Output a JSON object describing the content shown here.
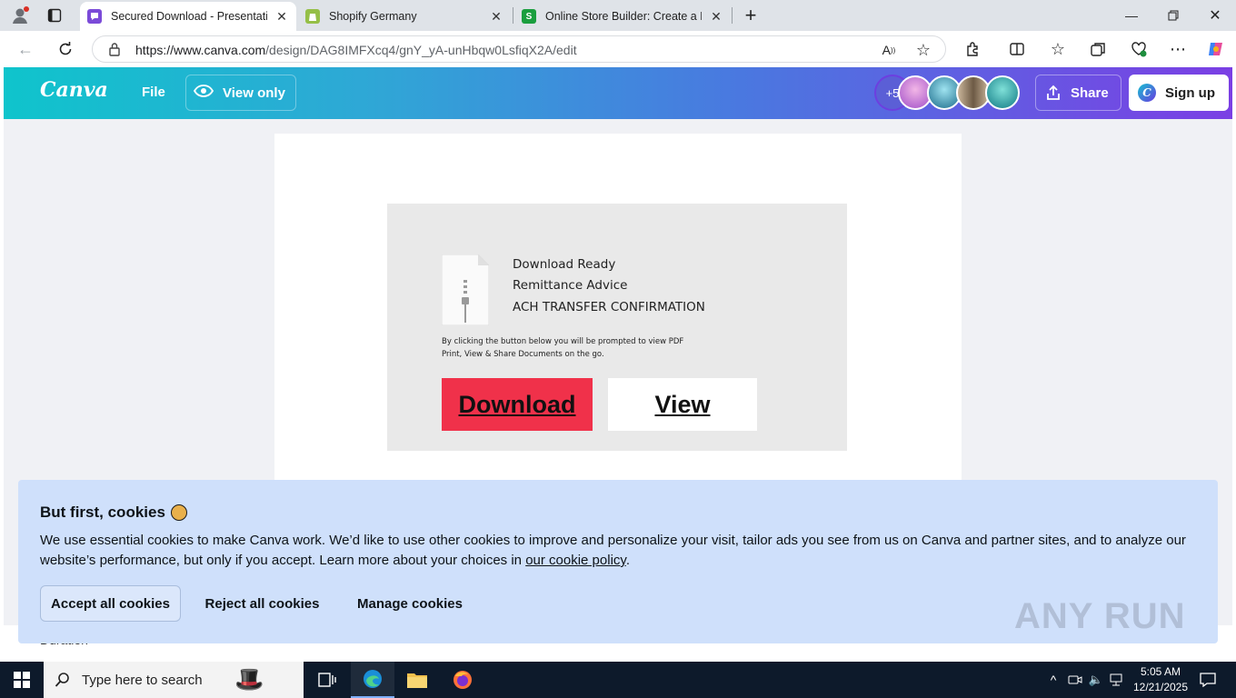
{
  "browser": {
    "tabs": [
      {
        "title": "Secured Download - Presentation",
        "active": true
      },
      {
        "title": "Shopify Germany",
        "active": false
      },
      {
        "title": "Online Store Builder: Create a Free",
        "active": false
      }
    ],
    "url_host": "https://www.canva.com",
    "url_path": "/design/DAG8IMFXcq4/gnY_yA-unHbqw0LsfiqX2A/edit"
  },
  "canva": {
    "logo": "Canva",
    "file_label": "File",
    "view_only_label": "View only",
    "collaborators_more": "+5",
    "share_label": "Share",
    "signup_label": "Sign up",
    "signup_badge": "C"
  },
  "design": {
    "line1": "Download Ready",
    "line2": "Remittance Advice",
    "line3": "ACH TRANSFER CONFIRMATION",
    "small1": "By clicking the button below you will be prompted to view PDF",
    "small2": "Print, View & Share Documents on the go.",
    "download_label": "Download",
    "view_label": "View",
    "colors": {
      "download_bg": "#f0314a",
      "card_bg": "#e9e9e9"
    }
  },
  "bottom_bar": {
    "duration_label": "Duration"
  },
  "cookie_banner": {
    "title": "But first, cookies",
    "text_before_link": "We use essential cookies to make Canva work. We’d like to use other cookies to improve and personalize your visit, tailor ads you see from us on Canva and partner sites, and to analyze our website’s performance, but only if you accept. Learn more about your choices in ",
    "link_text": "our cookie policy",
    "text_after_link": ".",
    "accept_label": "Accept all cookies",
    "reject_label": "Reject all cookies",
    "manage_label": "Manage cookies"
  },
  "watermark": "ANY RUN",
  "taskbar": {
    "search_placeholder": "Type here to search",
    "time": "5:05 AM",
    "date": "12/21/2025"
  }
}
